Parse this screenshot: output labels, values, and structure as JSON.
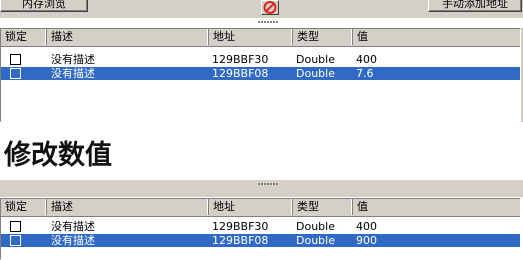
{
  "top_buttons": {
    "memory_browse": "内存浏览",
    "manual_add": "手动添加地址"
  },
  "colors": {
    "selection": "#316ac5",
    "window_face": "#d4d0c8",
    "cancel_icon": "#d9261c"
  },
  "icons": {
    "cancel": "no-entry-icon",
    "splitter": "grip-dots-icon"
  },
  "columns": [
    "锁定",
    "描述",
    "地址",
    "类型",
    "值"
  ],
  "list_before": {
    "rows": [
      {
        "locked": false,
        "description": "没有描述",
        "address": "129BBF30",
        "type": "Double",
        "value": "400",
        "selected": false
      },
      {
        "locked": false,
        "description": "没有描述",
        "address": "129BBF08",
        "type": "Double",
        "value": "7.6",
        "selected": true
      }
    ]
  },
  "heading": "修改数值",
  "list_after": {
    "rows": [
      {
        "locked": false,
        "description": "没有描述",
        "address": "129BBF30",
        "type": "Double",
        "value": "400",
        "selected": false
      },
      {
        "locked": false,
        "description": "没有描述",
        "address": "129BBF08",
        "type": "Double",
        "value": "900",
        "selected": true
      }
    ]
  }
}
